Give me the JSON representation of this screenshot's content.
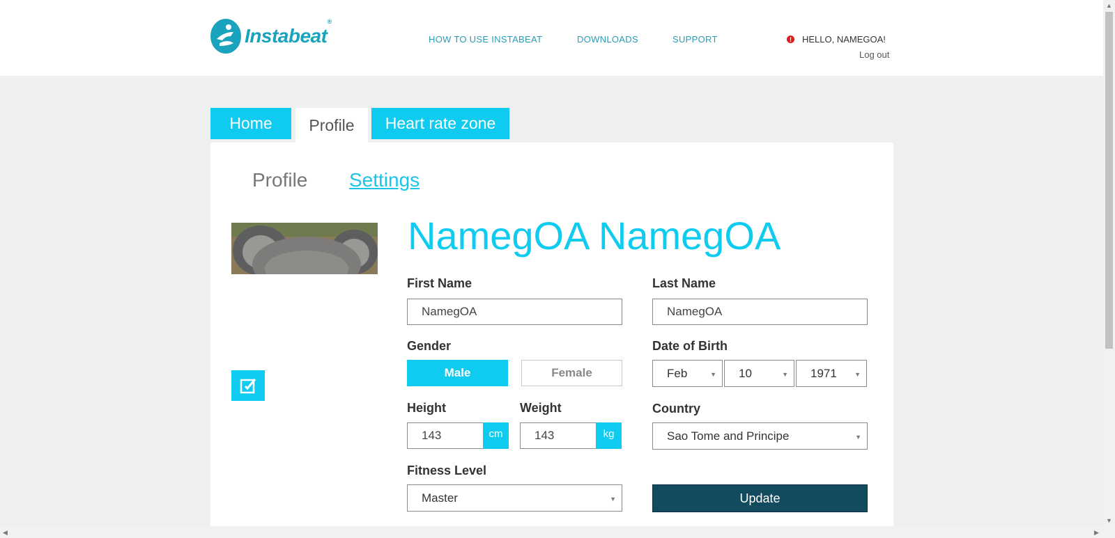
{
  "brand": {
    "name": "Instabeat",
    "reg": "®",
    "accent": "#0fcbf0",
    "dark": "#124a5e"
  },
  "nav": {
    "how_to": "HOW TO USE INSTABEAT",
    "downloads": "DOWNLOADS",
    "support": "SUPPORT"
  },
  "user": {
    "greeting": "HELLO, NAMEGOA!",
    "logout": "Log out",
    "alert_icon": "!"
  },
  "tabs": [
    {
      "label": "Home",
      "active": false
    },
    {
      "label": "Profile",
      "active": true
    },
    {
      "label": "Heart rate zone",
      "active": false
    }
  ],
  "sub_tabs": {
    "profile": "Profile",
    "settings": "Settings"
  },
  "profile": {
    "full_name": "NamegOA NamegOA",
    "first_name_label": "First Name",
    "first_name": "NamegOA",
    "last_name_label": "Last Name",
    "last_name": "NamegOA",
    "gender_label": "Gender",
    "gender_male": "Male",
    "gender_female": "Female",
    "gender_selected": "Male",
    "dob_label": "Date of Birth",
    "dob_month": "Feb",
    "dob_day": "10",
    "dob_year": "1971",
    "height_label": "Height",
    "height": "143",
    "height_unit": "cm",
    "weight_label": "Weight",
    "weight": "143",
    "weight_unit": "kg",
    "country_label": "Country",
    "country": "Sao Tome and Principe",
    "fitness_label": "Fitness Level",
    "fitness": "Master",
    "update_label": "Update"
  }
}
